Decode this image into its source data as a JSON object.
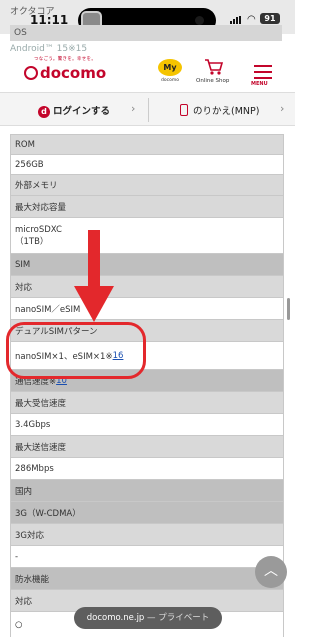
{
  "status": {
    "time": "11:11",
    "battery": "91"
  },
  "ghost": {
    "line1": "オクタコア",
    "line2": "OS",
    "line3": "Android™ 15※15"
  },
  "header": {
    "tagline": "つなごう。驚きを。幸せを。",
    "logo": "docomo",
    "my_label": "My",
    "my_sub": "docomo",
    "shop_label": "Online Shop",
    "menu_label": "MENU"
  },
  "login": {
    "login_label": "ログインする",
    "login_icon": "d",
    "mnp_label": "のりかえ(MNP)",
    "chevron": "›"
  },
  "spec_rows": [
    {
      "text": "ROM",
      "style": "gray"
    },
    {
      "text": "256GB",
      "style": "white"
    },
    {
      "text": "外部メモリ",
      "style": "gray"
    },
    {
      "text": "最大対応容量",
      "style": "gray"
    },
    {
      "text": "microSDXC",
      "text2": "（1TB）",
      "style": "white"
    },
    {
      "text": "SIM",
      "style": "dark"
    },
    {
      "text": "対応",
      "style": "gray"
    },
    {
      "text": "nanoSIM／eSIM",
      "style": "white"
    },
    {
      "text": "デュアルSIMパターン",
      "style": "gray"
    },
    {
      "text": "nanoSIM×1、eSIM×1※",
      "link": "16",
      "style": "white"
    },
    {
      "text": "通信速度※",
      "link": "10",
      "style": "dark"
    },
    {
      "text": "最大受信速度",
      "style": "gray"
    },
    {
      "text": "3.4Gbps",
      "style": "white"
    },
    {
      "text": "最大送信速度",
      "style": "gray"
    },
    {
      "text": "286Mbps",
      "style": "white"
    },
    {
      "text": "国内",
      "style": "dark"
    },
    {
      "text": "3G（W-CDMA）",
      "style": "dark"
    },
    {
      "text": "3G対応",
      "style": "gray"
    },
    {
      "text": "-",
      "style": "white"
    },
    {
      "text": "防水機能",
      "style": "dark"
    },
    {
      "text": "対応",
      "style": "gray"
    },
    {
      "text": "○",
      "style": "white"
    }
  ],
  "url_bar": {
    "domain": "docomo.ne.jp",
    "mode": "— プライベート"
  },
  "colors": {
    "brand": "#c3052b",
    "annotation": "#e3282c",
    "link": "#1a4fb0"
  },
  "icons": {
    "scroll_top": "chevron-up-icon",
    "cart": "cart-icon",
    "menu": "hamburger-icon"
  }
}
